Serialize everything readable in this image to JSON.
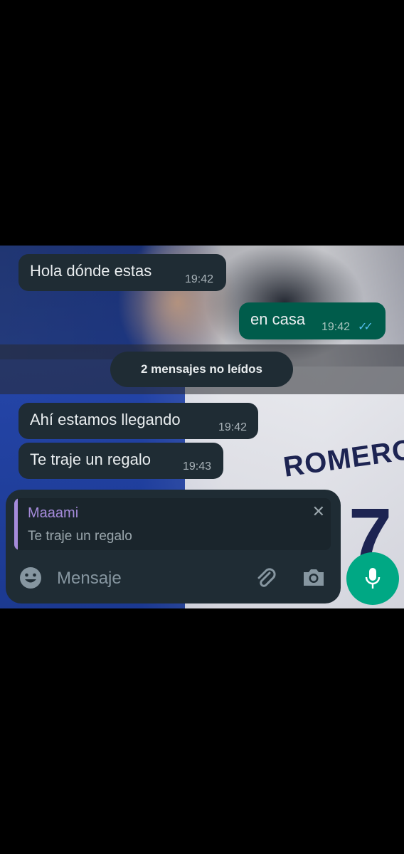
{
  "messages": [
    {
      "direction": "in",
      "text": "Hola dónde estas",
      "time": "19:42"
    },
    {
      "direction": "out",
      "text": "en casa",
      "time": "19:42",
      "status": "read"
    },
    {
      "direction": "in",
      "text": "Ahí estamos llegando",
      "time": "19:42"
    },
    {
      "direction": "in",
      "text": "Te traje un regalo",
      "time": "19:43"
    }
  ],
  "unread_banner": "2 mensajes no leídos",
  "wallpaper": {
    "jersey_name": "ROMERO",
    "jersey_number": "7"
  },
  "reply_preview": {
    "sender": "Maaami",
    "text": "Te traje un regalo",
    "close_icon": "close-icon"
  },
  "composer": {
    "placeholder": "Mensaje",
    "value": ""
  },
  "icons": {
    "emoji": "emoji-icon",
    "attach": "paperclip-icon",
    "camera": "camera-icon",
    "mic": "mic-icon"
  },
  "colors": {
    "incoming_bubble": "#1f2c34",
    "outgoing_bubble": "#005c4b",
    "accent": "#00a884",
    "reply_accent": "#a58bdb",
    "read_ticks": "#53bdeb"
  }
}
